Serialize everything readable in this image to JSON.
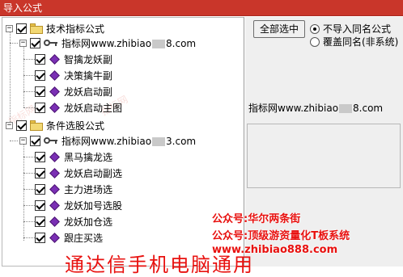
{
  "window": {
    "title": "导入公式"
  },
  "tree": {
    "groups": [
      {
        "label": "技术指标公式",
        "source": {
          "label_prefix": "指标网www.zhibiao",
          "label_suffix": "8.com"
        },
        "items": [
          "智擒龙妖副",
          "决策擒牛副",
          "龙妖启动副",
          "龙妖启动主图"
        ]
      },
      {
        "label": "条件选股公式",
        "source": {
          "label_prefix": "指标网www.zhibiao",
          "label_suffix": "3.com"
        },
        "items": [
          "黑马擒龙选",
          "龙妖启动副选",
          "主力进场选",
          "龙妖加号选股",
          "龙妖加仓选",
          "跟庄买选"
        ]
      }
    ]
  },
  "right": {
    "select_all_button": "全部选中",
    "options": [
      "不导入同名公式",
      "覆盖同名(非系统)"
    ],
    "selected_option": "不导入同名公式",
    "source_prefix": "指标网www.zhibiao",
    "source_suffix": "8.com"
  },
  "overlay": {
    "line1": "公众号:华尔两条街",
    "line2": "公众号:顶级游资量化T板系统",
    "line3": "www.zhibiao888.com",
    "bottom": "通达信手机电脑通用",
    "watermark": "指标网"
  },
  "colors": {
    "titlebar": "#c9362a",
    "overlay_text": "#e8110f",
    "item_icon": "#7a2fb4"
  }
}
